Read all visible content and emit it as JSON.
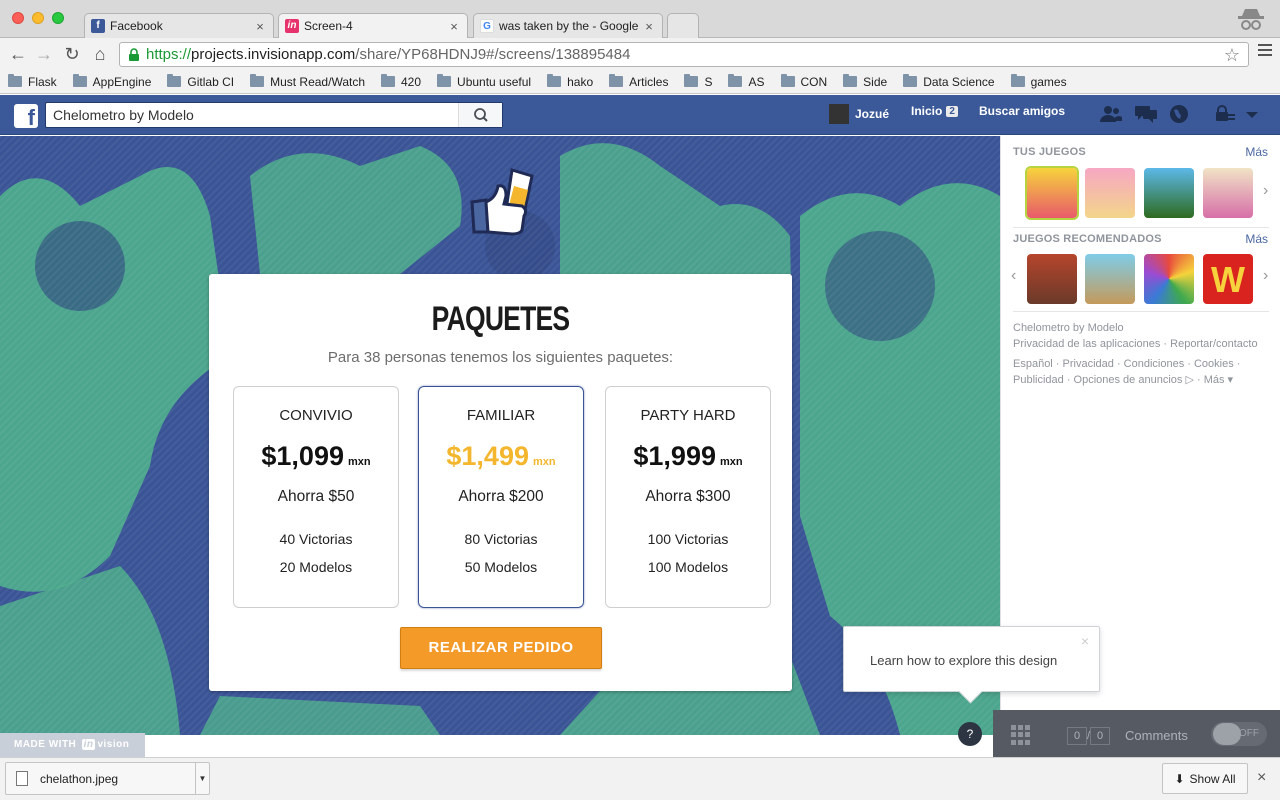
{
  "browser": {
    "tabs": [
      {
        "label": "Facebook",
        "favicon": "facebook-icon"
      },
      {
        "label": "Screen-4",
        "favicon": "invision-icon"
      },
      {
        "label": "was taken by the - Google S",
        "favicon": "google-icon"
      }
    ],
    "url": {
      "scheme": "https://",
      "host": "projects.invisionapp.com",
      "path": "/share/YP68HDNJ9#/screens/138895484"
    },
    "bookmarks": [
      "Flask",
      "AppEngine",
      "Gitlab CI",
      "Must Read/Watch",
      "420",
      "Ubuntu useful",
      "hako",
      "Articles",
      "S",
      "AS",
      "CON",
      "Side",
      "Data Science",
      "games"
    ]
  },
  "facebook": {
    "search_value": "Chelometro by Modelo",
    "user_name": "Jozué",
    "home_label": "Inicio",
    "home_count": "2",
    "find_friends": "Buscar amigos"
  },
  "card": {
    "title": "PAQUETES",
    "subtitle": "Para 38 personas tenemos los siguientes paquetes:",
    "currency": "mxn",
    "packages": [
      {
        "name": "CONVIVIO",
        "price": "$1,099",
        "savings": "Ahorra $50",
        "line1": "40 Victorias",
        "line2": "20 Modelos"
      },
      {
        "name": "FAMILIAR",
        "price": "$1,499",
        "savings": "Ahorra $200",
        "line1": "80 Victorias",
        "line2": "50 Modelos"
      },
      {
        "name": "PARTY HARD",
        "price": "$1,999",
        "savings": "Ahorra $300",
        "line1": "100 Victorias",
        "line2": "100 Modelos"
      }
    ],
    "order_button": "REALIZAR PEDIDO"
  },
  "sidebar": {
    "your_games": "TUS JUEGOS",
    "recommended": "JUEGOS RECOMENDADOS",
    "more": "Más",
    "app_name": "Chelometro by Modelo",
    "privacy_apps": "Privacidad de las aplicaciones",
    "report": "Reportar/contacto",
    "footer_line1": "Español · Privacidad · Condiciones · Cookies ·",
    "footer_line2": "Publicidad · Opciones de anuncios",
    "footer_more": "Más"
  },
  "invision": {
    "made_with": "MADE WITH",
    "brand_in": "in",
    "brand_vision": "vision",
    "tooltip": "Learn how to explore this design",
    "help": "?",
    "page_current": "0",
    "page_total": "0",
    "comments": "Comments",
    "toggle": "OFF"
  },
  "downloads": {
    "file": "chelathon.jpeg",
    "show_all": "Show All"
  },
  "colors": {
    "fb_blue": "#3b5998",
    "accent_orange": "#f39a28",
    "price_highlight": "#f3b62c",
    "canvas_blue": "#3a5496",
    "canvas_green": "#4fae8c"
  }
}
